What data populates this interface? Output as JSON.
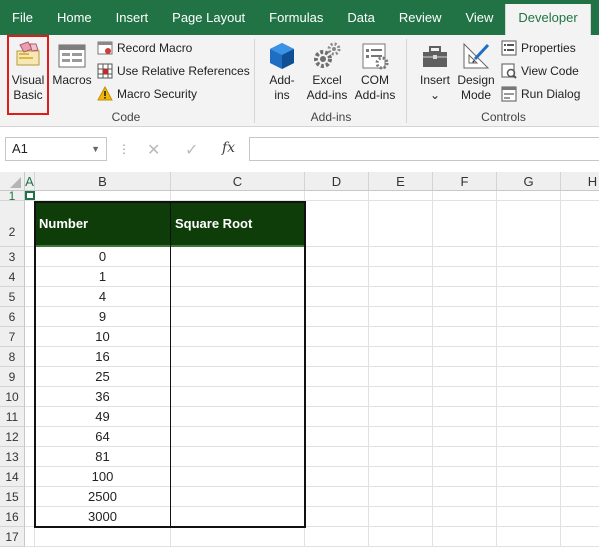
{
  "tabs": [
    {
      "label": "File",
      "active": false
    },
    {
      "label": "Home",
      "active": false
    },
    {
      "label": "Insert",
      "active": false
    },
    {
      "label": "Page Layout",
      "active": false
    },
    {
      "label": "Formulas",
      "active": false
    },
    {
      "label": "Data",
      "active": false
    },
    {
      "label": "Review",
      "active": false
    },
    {
      "label": "View",
      "active": false
    },
    {
      "label": "Developer",
      "active": true
    }
  ],
  "ribbon": {
    "code": {
      "group_label": "Code",
      "visual_basic_line1": "Visual",
      "visual_basic_line2": "Basic",
      "macros": "Macros",
      "record_macro": "Record Macro",
      "use_relative": "Use Relative References",
      "macro_security": "Macro Security"
    },
    "addins": {
      "group_label": "Add-ins",
      "addins_line1": "Add-",
      "addins_line2": "ins",
      "excel_line1": "Excel",
      "excel_line2": "Add-ins",
      "com_line1": "COM",
      "com_line2": "Add-ins"
    },
    "controls": {
      "group_label": "Controls",
      "insert": "Insert",
      "insert_caret": "⌄",
      "design_line1": "Design",
      "design_line2": "Mode",
      "properties": "Properties",
      "view_code": "View Code",
      "run_dialog": "Run Dialog"
    }
  },
  "formula_bar": {
    "name_box": "A1",
    "name_box_caret": "▼",
    "cancel_glyph": "✕",
    "enter_glyph": "✓",
    "fx_glyph": "fx",
    "formula": ""
  },
  "columns": [
    "A",
    "B",
    "C",
    "D",
    "E",
    "F",
    "G",
    "H"
  ],
  "rows": [
    "1",
    "2",
    "3",
    "4",
    "5",
    "6",
    "7",
    "8",
    "9",
    "10",
    "11",
    "12",
    "13",
    "14",
    "15",
    "16",
    "17"
  ],
  "table": {
    "header": [
      "Number",
      "Square Root"
    ],
    "numbers": [
      "0",
      "1",
      "4",
      "9",
      "10",
      "16",
      "25",
      "36",
      "49",
      "64",
      "81",
      "100",
      "2500",
      "3000"
    ]
  },
  "colors": {
    "excel_green": "#217346",
    "table_header_bg": "#0e3d0a",
    "highlight_red": "#e11a1a"
  }
}
